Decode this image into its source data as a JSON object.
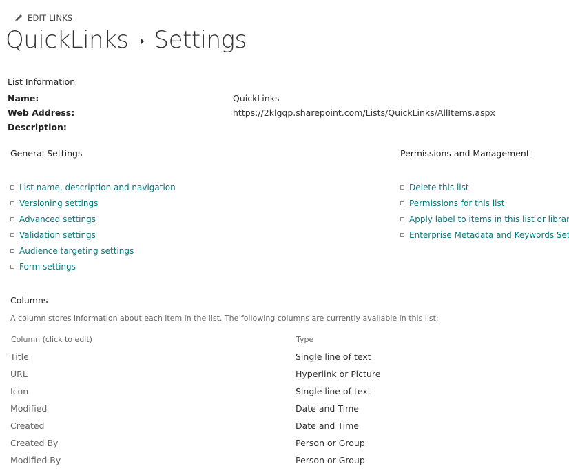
{
  "toolbar": {
    "edit_links": "EDIT LINKS"
  },
  "title": {
    "list_name": "QuickLinks",
    "page": "Settings"
  },
  "list_info": {
    "heading": "List Information",
    "name_label": "Name:",
    "name_value": "QuickLinks",
    "address_label": "Web Address:",
    "address_value": "https://2klgqp.sharepoint.com/Lists/QuickLinks/AllItems.aspx",
    "description_label": "Description:"
  },
  "general": {
    "heading": "General Settings",
    "links": [
      "List name, description and navigation",
      "Versioning settings",
      "Advanced settings",
      "Validation settings",
      "Audience targeting settings",
      "Form settings"
    ]
  },
  "permissions": {
    "heading": "Permissions and Management",
    "links": [
      "Delete this list",
      "Permissions for this list",
      "Apply label to items in this list or library",
      "Enterprise Metadata and Keywords Settings"
    ]
  },
  "columns": {
    "heading": "Columns",
    "description": "A column stores information about each item in the list. The following columns are currently available in this list:",
    "header_name": "Column (click to edit)",
    "header_type": "Type",
    "rows": [
      {
        "name": "Title",
        "type": "Single line of text"
      },
      {
        "name": "URL",
        "type": "Hyperlink or Picture"
      },
      {
        "name": "Icon",
        "type": "Single line of text"
      },
      {
        "name": "Modified",
        "type": "Date and Time"
      },
      {
        "name": "Created",
        "type": "Date and Time"
      },
      {
        "name": "Created By",
        "type": "Person or Group"
      },
      {
        "name": "Modified By",
        "type": "Person or Group"
      }
    ]
  },
  "colors": {
    "link": "#03787c",
    "text": "#333333",
    "muted": "#666666"
  },
  "icons": {
    "edit": "pencil-icon",
    "breadcrumb_separator": "triangle-right-icon",
    "bullet": "square-bullet-icon"
  }
}
